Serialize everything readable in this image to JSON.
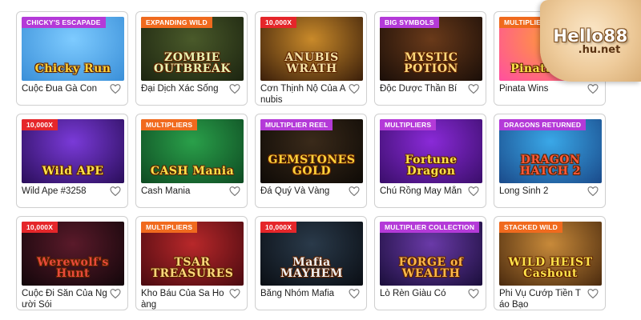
{
  "logo": {
    "main": "Hello88",
    "sub": ".hu.net"
  },
  "games": [
    {
      "name": "Cuộc Đua Gà Con",
      "badge": "CHICKY'S ESCAPADE",
      "badge_color": "#b43ad8",
      "art_title": "Chicky Run",
      "bg_top": "#7ecbff",
      "bg_bottom": "#3a8fd8",
      "title_color": "#ffd23a"
    },
    {
      "name": "Đại Dịch Xác Sống",
      "badge": "EXPANDING WILD",
      "badge_color": "#f06a1e",
      "art_title": "ZOMBIE OUTBREAK",
      "bg_top": "#4a5a2a",
      "bg_bottom": "#1c2410",
      "title_color": "#e9f2b0"
    },
    {
      "name": "Cơn Thịnh Nộ Của Anubis",
      "badge": "10,000x",
      "badge_color": "#e5262a",
      "art_title": "ANUBIS WRATH",
      "bg_top": "#c98a2a",
      "bg_bottom": "#3a1e0a",
      "title_color": "#f7e3a6"
    },
    {
      "name": "Độc Dược Thần Bí",
      "badge": "BIG SYMBOLS",
      "badge_color": "#b43ad8",
      "art_title": "MYSTIC POTION",
      "bg_top": "#6a3a1a",
      "bg_bottom": "#1a0e08",
      "title_color": "#ffd77a"
    },
    {
      "name": "Pinata Wins",
      "badge": "MULTIPLIERS",
      "badge_color": "#f06a1e",
      "art_title": "Pinata Wins",
      "bg_top": "#ff9a3a",
      "bg_bottom": "#ff4fa0",
      "title_color": "#ffe24a"
    },
    {
      "name": "Wild Ape #3258",
      "badge": "10,000x",
      "badge_color": "#e5262a",
      "art_title": "Wild APE",
      "bg_top": "#7a3ad8",
      "bg_bottom": "#2a0e5a",
      "title_color": "#ffe24a"
    },
    {
      "name": "Cash Mania",
      "badge": "MULTIPLIERS",
      "badge_color": "#f06a1e",
      "art_title": "CASH Mania",
      "bg_top": "#2aa04a",
      "bg_bottom": "#0e4a22",
      "title_color": "#ffe24a"
    },
    {
      "name": "Đá Quý Và Vàng",
      "badge": "MULTIPLIER REEL",
      "badge_color": "#b43ad8",
      "art_title": "GEMSTONES GOLD",
      "bg_top": "#3a2a1a",
      "bg_bottom": "#0e0a06",
      "title_color": "#ffd23a"
    },
    {
      "name": "Chú Rồng May Mắn",
      "badge": "MULTIPLIERS",
      "badge_color": "#b43ad8",
      "art_title": "Fortune Dragon",
      "bg_top": "#8a2ad8",
      "bg_bottom": "#3a0e6a",
      "title_color": "#ffe24a"
    },
    {
      "name": "Long Sinh 2",
      "badge": "DRAGONS RETURNED",
      "badge_color": "#b43ad8",
      "art_title": "DRAGON HATCH 2",
      "bg_top": "#3aa8e8",
      "bg_bottom": "#1a4a8a",
      "title_color": "#ff5a3a"
    },
    {
      "name": "Cuộc Đi Săn Của Người Sói",
      "badge": "10,000x",
      "badge_color": "#e5262a",
      "art_title": "Werewolf's Hunt",
      "bg_top": "#5a1a2a",
      "bg_bottom": "#12060a",
      "title_color": "#e84a3a"
    },
    {
      "name": "Kho Báu Của Sa Hoàng",
      "badge": "MULTIPLIERS",
      "badge_color": "#f06a1e",
      "art_title": "TSAR TREASURES",
      "bg_top": "#b8282a",
      "bg_bottom": "#4a0a10",
      "title_color": "#ffd77a"
    },
    {
      "name": "Băng Nhóm Mafia",
      "badge": "10,000x",
      "badge_color": "#e5262a",
      "art_title": "Mafia MAYHEM",
      "bg_top": "#2a3a4a",
      "bg_bottom": "#0a0e14",
      "title_color": "#f0f0f0"
    },
    {
      "name": "Lò Rèn Giàu Có",
      "badge": "MULTIPLIER COLLECTION",
      "badge_color": "#b43ad8",
      "art_title": "FORGE of WEALTH",
      "bg_top": "#6a3aa8",
      "bg_bottom": "#1a0e3a",
      "title_color": "#ffb84a"
    },
    {
      "name": "Phi Vụ Cướp Tiền Táo Bạo",
      "badge": "STACKED WILD",
      "badge_color": "#f06a1e",
      "art_title": "WILD HEIST Cashout",
      "bg_top": "#c88a3a",
      "bg_bottom": "#4a2a0e",
      "title_color": "#ffe24a"
    }
  ]
}
